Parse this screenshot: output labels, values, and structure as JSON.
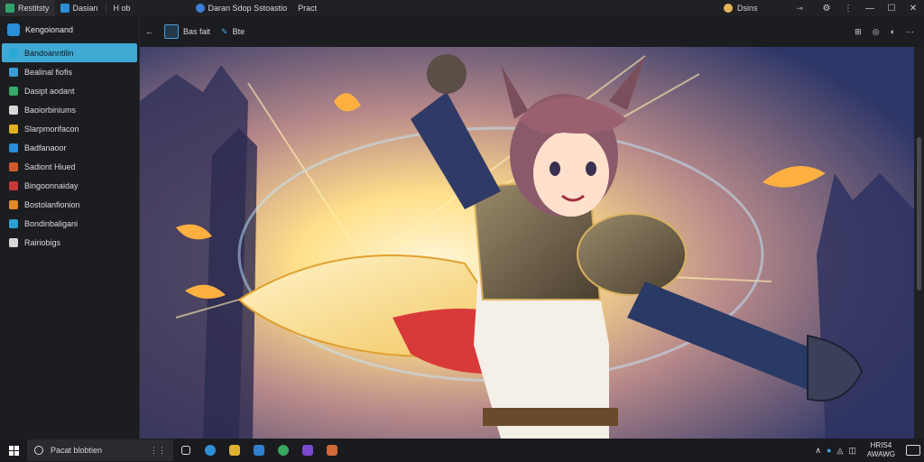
{
  "titlebar": {
    "tabs": [
      {
        "label": "Restitsty",
        "icon": "app-icon",
        "color": "#2fa36b"
      },
      {
        "label": "Dasian",
        "icon": "browser-icon",
        "color": "#2a8fd6"
      },
      {
        "label": "H ob",
        "icon": "new-tab-icon",
        "color": "#9a9a9a"
      },
      {
        "label": "Daran Sdop Sstoastio",
        "icon": "edge-icon",
        "color": "#3b7fd6"
      },
      {
        "label": "Pract",
        "icon": "page-icon",
        "color": "#9a9a9a"
      }
    ],
    "search_text": "Dsins",
    "window_controls": [
      "—",
      "☐",
      "✕"
    ]
  },
  "sidebar": {
    "header": "Kengoionand",
    "items": [
      {
        "label": "Bandoanntilin",
        "color": "#2aa8d8",
        "active": true
      },
      {
        "label": "Bealinal fiofis",
        "color": "#3a9bd6"
      },
      {
        "label": "Dasipt aodant",
        "color": "#3aa86a"
      },
      {
        "label": "Baoiorbiniums",
        "color": "#d8d8d8"
      },
      {
        "label": "Slarpmorifacon",
        "color": "#e0b020"
      },
      {
        "label": "Badfanaoor",
        "color": "#2a8fd6"
      },
      {
        "label": "Sadiont Hiued",
        "color": "#d05a2a"
      },
      {
        "label": "Bingoonnaiday",
        "color": "#c83a3a"
      },
      {
        "label": "Bostolanfionion",
        "color": "#e08a2a"
      },
      {
        "label": "Bondinbaligani",
        "color": "#2a9fd6"
      },
      {
        "label": "Rairiobigs",
        "color": "#d8d8d8"
      }
    ]
  },
  "toolbar": {
    "back": "←",
    "btn1": "Bas fait",
    "btn2": "Bte",
    "right_icons": [
      "⊞",
      "◎",
      "◐",
      "⋯"
    ]
  },
  "taskbar": {
    "search_placeholder": "Pacat blobtien",
    "mic": "⋮⋮",
    "clock_time": "HRIS4",
    "clock_date": "AWAWG"
  },
  "colors": {
    "accent": "#3ea9d3",
    "bg": "#1b1c20"
  }
}
